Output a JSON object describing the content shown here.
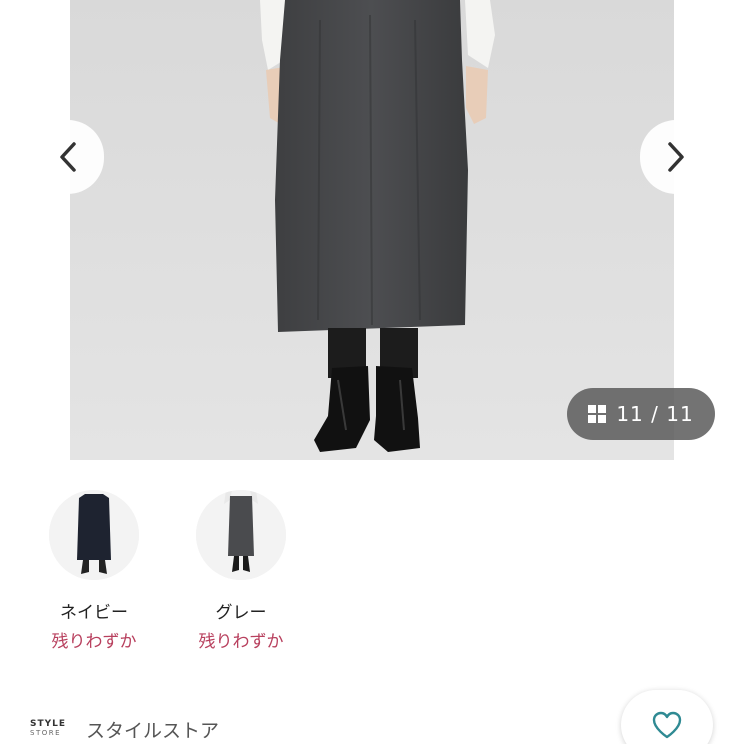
{
  "gallery": {
    "counter_text": "11 / 11",
    "prev_icon": "chevron-left-icon",
    "next_icon": "chevron-right-icon",
    "grid_icon": "grid-icon"
  },
  "colors": {
    "sale_text": "#b8405e",
    "counter_bg": "#5c5c5c"
  },
  "swatches": [
    {
      "name": "ネイビー",
      "stock": "残りわずか"
    },
    {
      "name": "グレー",
      "stock": "残りわずか"
    }
  ],
  "store": {
    "logo_line1": "STYLE",
    "logo_line2": "STORE",
    "name": "スタイルストア",
    "favorite_icon": "heart-icon"
  }
}
